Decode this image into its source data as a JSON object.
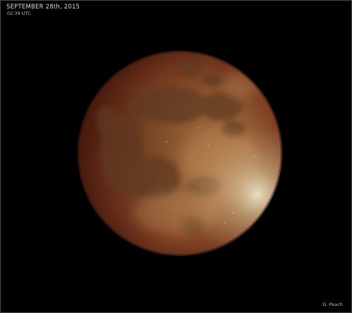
{
  "caption": {
    "date": "SEPTEMBER 28th, 2015",
    "time": "02:39 UTC"
  },
  "credit": "D. Peach",
  "colors": {
    "background": "#000000",
    "moon_core": "#a06a3a",
    "moon_edge": "#4a1c10",
    "limb_highlight": "#e8dcc0"
  }
}
